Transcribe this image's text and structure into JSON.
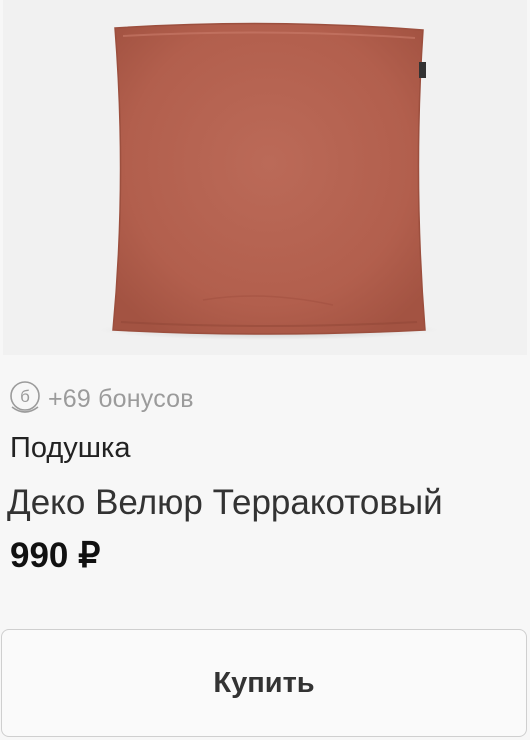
{
  "product": {
    "image_icon": "pillow-image",
    "color": "#b4614f",
    "bonus_icon": "bonus-coin-icon",
    "bonus_text": "+69 бонусов",
    "category": "Подушка",
    "name": "Деко Велюр Терракотовый",
    "price": "990 ₽"
  },
  "actions": {
    "buy_label": "Купить"
  }
}
